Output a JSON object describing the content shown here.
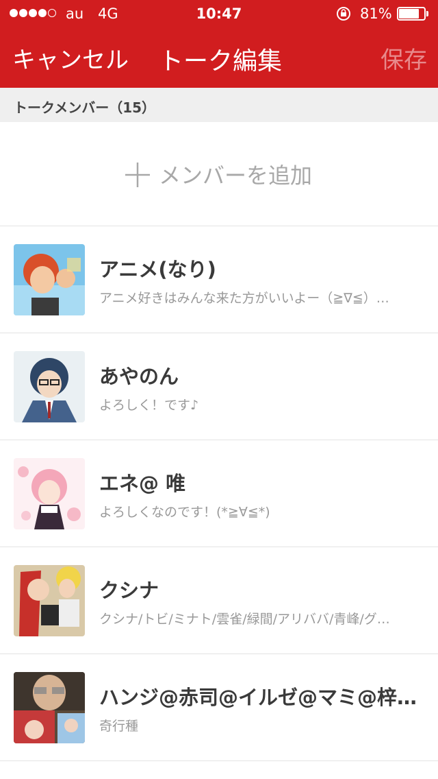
{
  "status_bar": {
    "carrier": "au",
    "network": "4G",
    "time": "10:47",
    "battery_percent": "81%",
    "battery_level": 0.81,
    "signal_bars_filled": 4,
    "signal_bars_total": 5
  },
  "nav": {
    "cancel_label": "キャンセル",
    "title": "トーク編集",
    "save_label": "保存"
  },
  "section": {
    "members_header": "トークメンバー（15）"
  },
  "add_member": {
    "label": "メンバーを追加"
  },
  "members": [
    {
      "name": "アニメ(なり)",
      "status": "アニメ好きはみんな来た方がいいよー（≧∇≦）…",
      "avatar": "avatar-red-hair-boy"
    },
    {
      "name": "あやのん",
      "status": "よろしく！です♪",
      "avatar": "avatar-glasses-boy"
    },
    {
      "name": "エネ@ 唯",
      "status": "よろしくなのです！(*≧∀≦*)",
      "avatar": "avatar-pink-hair-girl"
    },
    {
      "name": "クシナ",
      "status": "クシナ/トビ/ミナト/雲雀/緑間/アリババ/青峰/グ…",
      "avatar": "avatar-red-hair-couple"
    },
    {
      "name": "ハンジ@赤司@イルゼ@マミ@梓…",
      "status": "奇行種",
      "avatar": "avatar-collage"
    }
  ],
  "colors": {
    "brand_red": "#d11d1f",
    "save_disabled": "#e8898b",
    "section_bg": "#efefef"
  }
}
